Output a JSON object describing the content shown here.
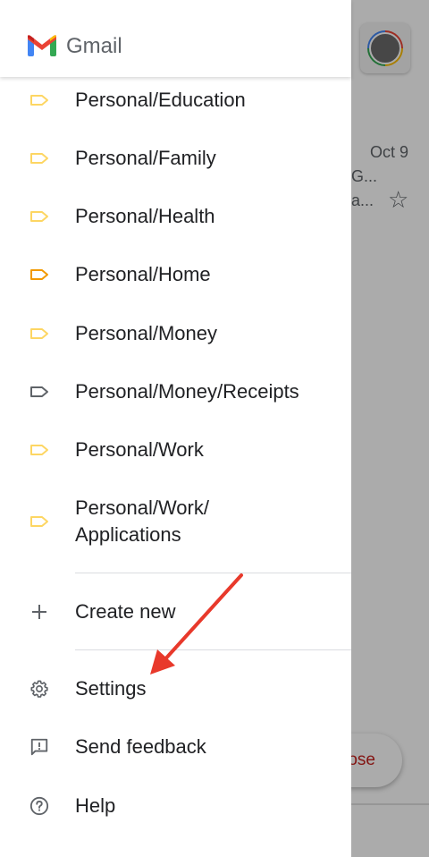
{
  "app": {
    "name": "Gmail"
  },
  "inbox_peek": {
    "date": "Oct 9",
    "snippet_line1": "G...",
    "snippet_line2": "a...",
    "compose_label": "ose"
  },
  "labels": [
    {
      "text": "Personal/Education",
      "color": "#fdd663"
    },
    {
      "text": "Personal/Family",
      "color": "#fdd663"
    },
    {
      "text": "Personal/Health",
      "color": "#fdd663"
    },
    {
      "text": "Personal/Home",
      "color": "#f29900"
    },
    {
      "text": "Personal/Money",
      "color": "#fdd663"
    },
    {
      "text": "Personal/Money/Receipts",
      "color": "#5f6368"
    },
    {
      "text": "Personal/Work",
      "color": "#fdd663"
    },
    {
      "text": "Personal/Work/ Applications",
      "color": "#fdd663"
    }
  ],
  "actions": {
    "create_new": "Create new",
    "settings": "Settings",
    "send_feedback": "Send feedback",
    "help": "Help"
  },
  "colors": {
    "annotation_arrow": "#e8392b",
    "gmail_red": "#ea4335",
    "gmail_blue": "#4285f4",
    "gmail_green": "#34a853",
    "gmail_yellow": "#fbbc04"
  }
}
